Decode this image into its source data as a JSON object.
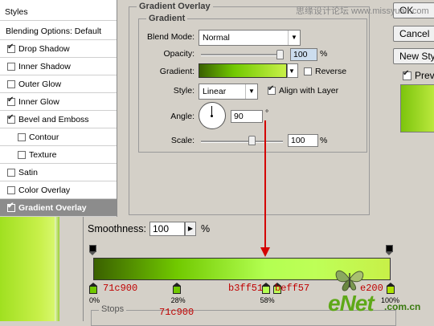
{
  "styles_panel": {
    "header": "Styles",
    "items": [
      {
        "label": "Blending Options: Default",
        "checkbox": false,
        "checked": false,
        "indent": false,
        "selected": false
      },
      {
        "label": "Drop Shadow",
        "checkbox": true,
        "checked": true,
        "indent": false,
        "selected": false
      },
      {
        "label": "Inner Shadow",
        "checkbox": true,
        "checked": false,
        "indent": false,
        "selected": false
      },
      {
        "label": "Outer Glow",
        "checkbox": true,
        "checked": false,
        "indent": false,
        "selected": false
      },
      {
        "label": "Inner Glow",
        "checkbox": true,
        "checked": true,
        "indent": false,
        "selected": false
      },
      {
        "label": "Bevel and Emboss",
        "checkbox": true,
        "checked": true,
        "indent": false,
        "selected": false
      },
      {
        "label": "Contour",
        "checkbox": true,
        "checked": false,
        "indent": true,
        "selected": false
      },
      {
        "label": "Texture",
        "checkbox": true,
        "checked": false,
        "indent": true,
        "selected": false
      },
      {
        "label": "Satin",
        "checkbox": true,
        "checked": false,
        "indent": false,
        "selected": false
      },
      {
        "label": "Color Overlay",
        "checkbox": true,
        "checked": false,
        "indent": false,
        "selected": false
      },
      {
        "label": "Gradient Overlay",
        "checkbox": true,
        "checked": true,
        "indent": false,
        "selected": true
      }
    ]
  },
  "dialog": {
    "group_title": "Gradient Overlay",
    "subgroup_title": "Gradient",
    "blend_mode_label": "Blend Mode:",
    "blend_mode_value": "Normal",
    "opacity_label": "Opacity:",
    "opacity_value": "100",
    "opacity_unit": "%",
    "gradient_label": "Gradient:",
    "reverse_label": "Reverse",
    "style_label": "Style:",
    "style_value": "Linear",
    "align_label": "Align with Layer",
    "angle_label": "Angle:",
    "angle_value": "90",
    "angle_unit": "°",
    "scale_label": "Scale:",
    "scale_value": "100",
    "scale_unit": "%"
  },
  "buttons": {
    "ok": "OK",
    "cancel": "Cancel",
    "new_style": "New Style...",
    "preview": "Preview"
  },
  "gradient_editor": {
    "smoothness_label": "Smoothness:",
    "smoothness_value": "100",
    "smoothness_unit": "%",
    "stops_label": "Stops",
    "stops_hex_below": "71c900",
    "color_stops": [
      {
        "color": "#71c900",
        "hex_label": "71c900",
        "location_label": "0%"
      },
      {
        "color": "#71c900",
        "hex_label": "",
        "location_label": "28%"
      },
      {
        "color": "#b3ff51",
        "hex_label": "b3ff51",
        "location_label": "58%"
      },
      {
        "color": "#beff57",
        "hex_label": "beff57",
        "location_label": ""
      },
      {
        "color": "#aee200",
        "hex_label": "e200",
        "location_label": "100%"
      }
    ]
  },
  "watermarks": {
    "top": "思缘设计论坛 www.missyuan.com",
    "brand": "eNet",
    "domain": ".com.cn"
  },
  "colors": {
    "gradient_start": "#3a6000",
    "gradient_end": "#c8f048",
    "selected_row": "#8c8c8c",
    "annotation_red": "#c00000"
  }
}
